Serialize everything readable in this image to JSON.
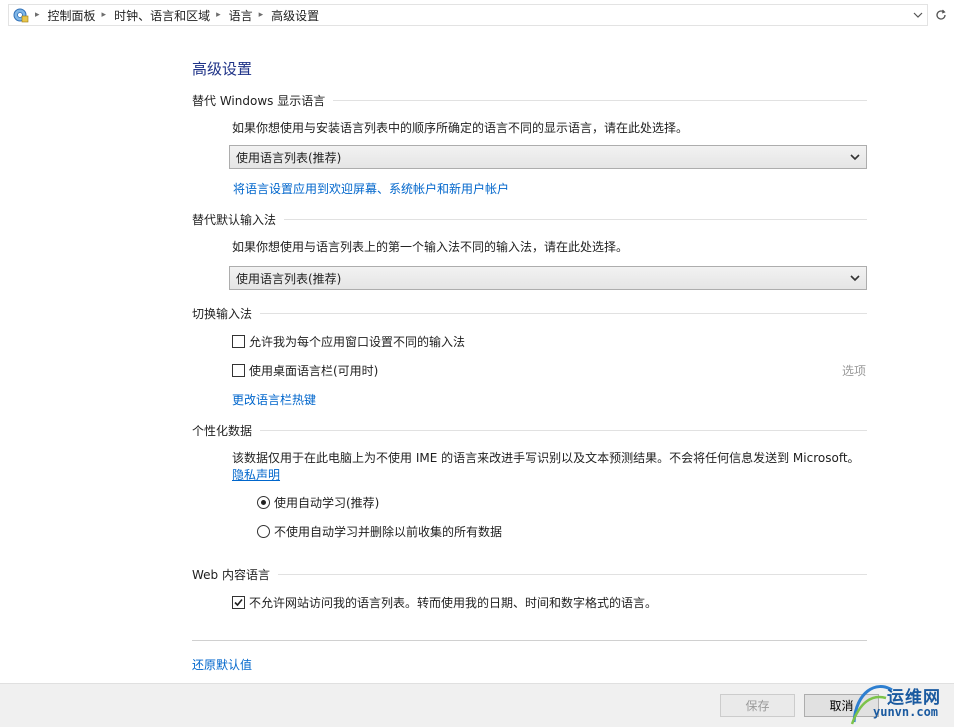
{
  "breadcrumb": {
    "items": [
      "控制面板",
      "时钟、语言和区域",
      "语言",
      "高级设置"
    ]
  },
  "page_title": "高级设置",
  "display_language": {
    "heading": "替代 Windows 显示语言",
    "description": "如果你想使用与安装语言列表中的顺序所确定的语言不同的显示语言，请在此处选择。",
    "selected": "使用语言列表(推荐)",
    "apply_link": "将语言设置应用到欢迎屏幕、系统帐户和新用户帐户"
  },
  "default_input": {
    "heading": "替代默认输入法",
    "description": "如果你想使用与语言列表上的第一个输入法不同的输入法，请在此处选择。",
    "selected": "使用语言列表(推荐)"
  },
  "switch_input": {
    "heading": "切换输入法",
    "option1": "允许我为每个应用窗口设置不同的输入法",
    "option1_checked": false,
    "option2": "使用桌面语言栏(可用时)",
    "option2_checked": false,
    "options_link": "选项",
    "hotkeys_link": "更改语言栏热键"
  },
  "personalization": {
    "heading": "个性化数据",
    "description": "该数据仅用于在此电脑上为不使用 IME 的语言来改进手写识别以及文本预测结果。不会将任何信息发送到 Microsoft。",
    "privacy_link": "隐私声明",
    "radio1": "使用自动学习(推荐)",
    "radio2": "不使用自动学习并删除以前收集的所有数据",
    "selected_radio": 1
  },
  "web_content": {
    "heading": "Web 内容语言",
    "option": "不允许网站访问我的语言列表。转而使用我的日期、时间和数字格式的语言。",
    "option_checked": true
  },
  "restore_defaults": "还原默认值",
  "footer": {
    "save_label": "保存",
    "cancel_label": "取消"
  },
  "watermark": {
    "cn": "运维网",
    "url": "yunvn.com"
  }
}
